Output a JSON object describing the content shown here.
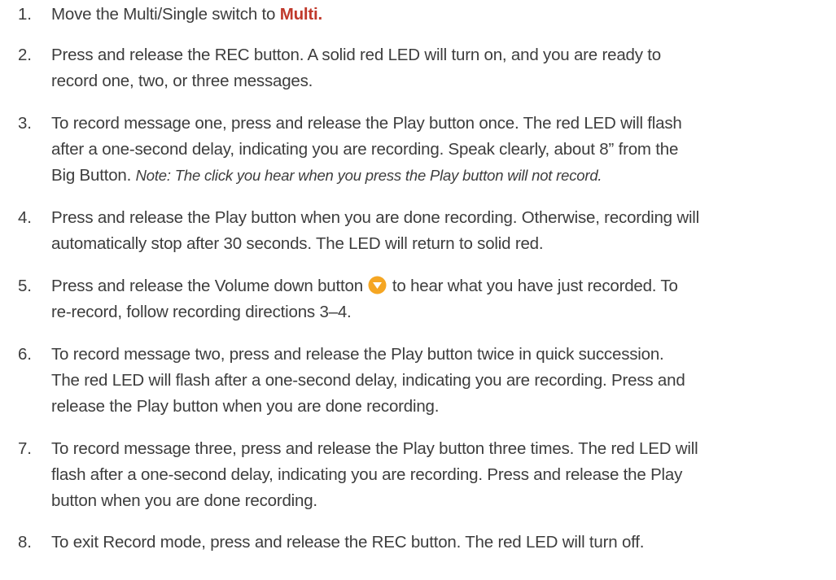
{
  "instructions": {
    "steps": [
      {
        "number": "1.",
        "text_before": "Move the Multi/Single switch to ",
        "emphasis": "Multi."
      },
      {
        "number": "2.",
        "lines": [
          "Press and release the REC button. A solid red LED will turn on, and you are ready to",
          "record one, two, or three messages."
        ]
      },
      {
        "number": "3.",
        "lines": [
          "To record message one, press and release the Play button once. The red LED will flash",
          "after a one-second delay, indicating you are recording. Speak clearly, about 8” from the"
        ],
        "last_line_text": "Big Button. ",
        "note": "Note: The click you hear when you press the Play button will not record."
      },
      {
        "number": "4.",
        "lines": [
          "Press and release the Play button when you are done recording. Otherwise, recording will",
          "automatically stop after 30 seconds. The LED will return to solid red."
        ]
      },
      {
        "number": "5.",
        "text_before_icon": "Press and release the Volume down button ",
        "icon": "volume-down-icon",
        "text_after_icon": " to hear what you have just recorded. To",
        "lines": [
          "re-record, follow recording directions 3–4."
        ]
      },
      {
        "number": "6.",
        "lines": [
          "To record message two, press and release the Play button twice in quick succession.",
          "The red LED will flash after a one-second delay, indicating you are recording. Press and",
          "release the Play button when you are done recording."
        ]
      },
      {
        "number": "7.",
        "lines": [
          "To record message three, press and release the Play button three times. The red LED will",
          "flash after a one-second delay, indicating you are recording. Press and release the Play",
          "button when you are done recording."
        ]
      },
      {
        "number": "8.",
        "lines": [
          "To exit Record mode, press and release the REC button. The red LED will turn off."
        ]
      }
    ]
  },
  "colors": {
    "text": "#3d3d3d",
    "emphasis": "#c0392b",
    "icon_fill": "#f5a623"
  }
}
